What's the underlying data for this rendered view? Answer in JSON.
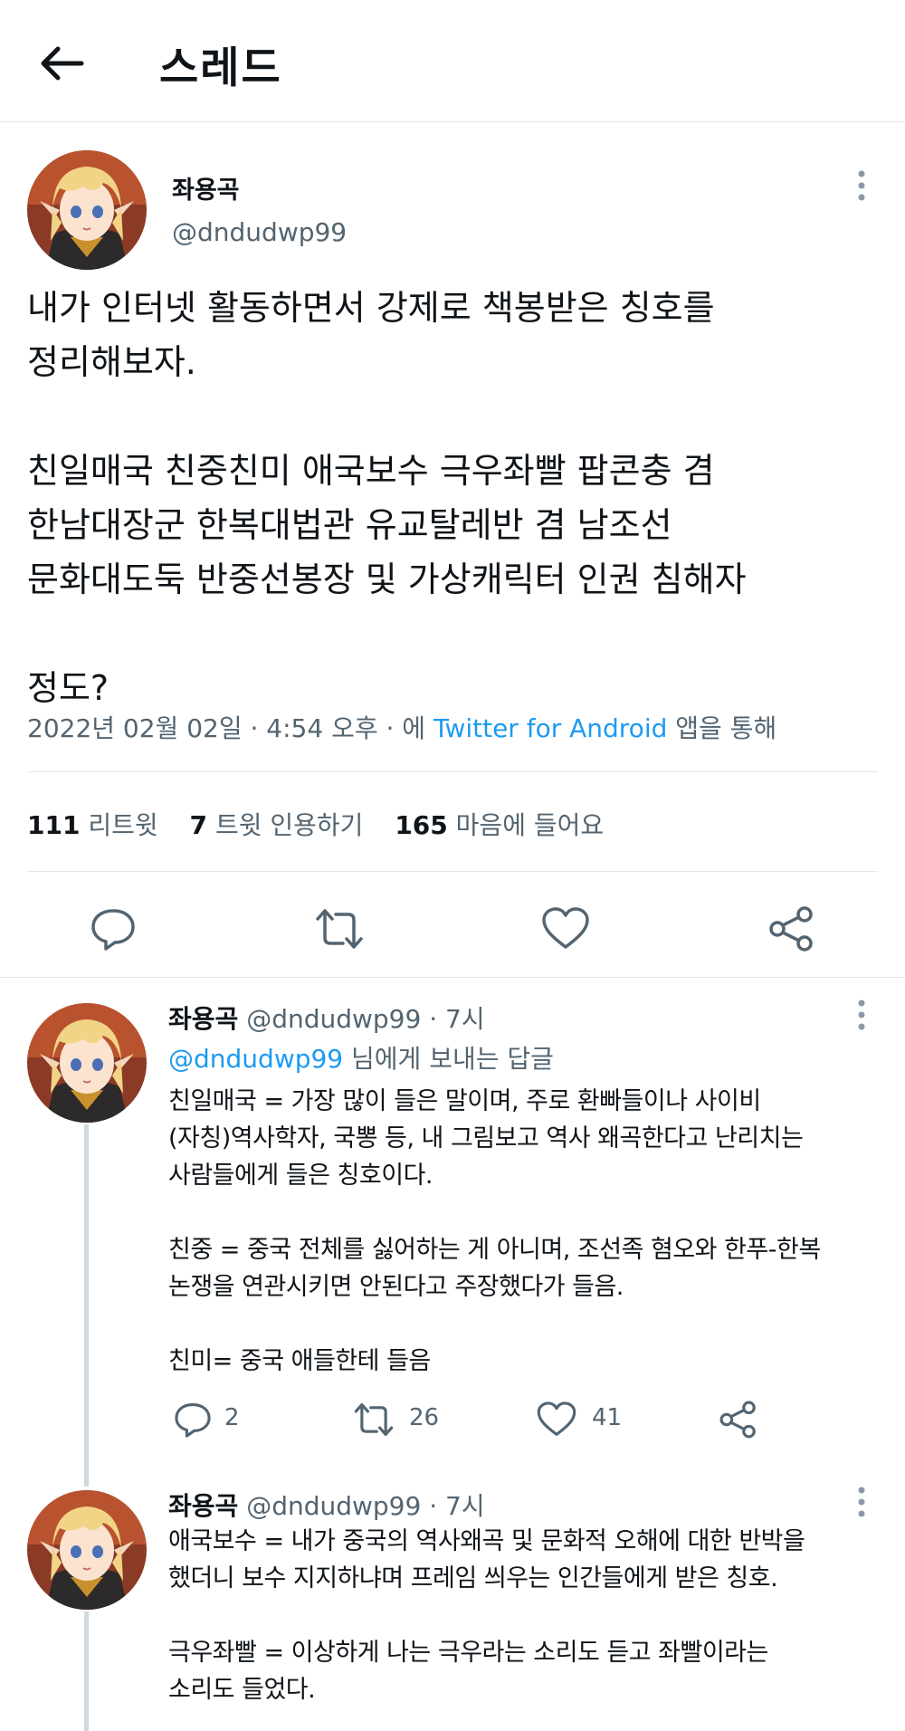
{
  "header": {
    "title": "스레드"
  },
  "main_tweet": {
    "name": "좌용곡",
    "handle": "@dndudwp99",
    "body": "내가 인터넷 활동하면서 강제로 책봉받은 칭호를\n정리해보자.\n\n친일매국 친중친미 애국보수 극우좌빨 팝콘충 겸\n한남대장군 한복대법관 유교탈레반 겸 남조선\n문화대도둑 반중선봉장 및 가상캐릭터 인권 침해자\n\n정도?",
    "meta_time": "2022년 02월 02일 · 4:54 오후 · 에 ",
    "meta_app": "Twitter for Android",
    "meta_suffix": " 앱을 통해",
    "stats": [
      {
        "num": "111",
        "label": "리트윗"
      },
      {
        "num": "7",
        "label": "트윗 인용하기"
      },
      {
        "num": "165",
        "label": "마음에 들어요"
      }
    ]
  },
  "replies": [
    {
      "name": "좌용곡",
      "handle": "@dndudwp99",
      "time": "· 7시",
      "reply_to_handle": "@dndudwp99",
      "reply_to_suffix": " 님에게 보내는 답글",
      "body": "친일매국 = 가장 많이 들은 말이며, 주로 환빠들이나 사이비\n(자칭)역사학자, 국뽕  등, 내 그림보고 역사 왜곡한다고 난리치는\n사람들에게 들은 칭호이다.\n\n친중 = 중국 전체를 싫어하는 게 아니며, 조선족 혐오와 한푸-한복\n논쟁을 연관시키면 안된다고 주장했다가 들음.\n\n친미= 중국 애들한테 들음",
      "replies_count": "2",
      "retweets_count": "26",
      "likes_count": "41"
    },
    {
      "name": "좌용곡",
      "handle": "@dndudwp99",
      "time": "· 7시",
      "body": "애국보수 = 내가 중국의 역사왜곡 및 문화적 오해에 대한 반박을\n했더니 보수 지지하냐며 프레임 씌우는 인간들에게 받은 칭호.\n\n극우좌빨 = 이상하게 나는 극우라는 소리도 듣고 좌빨이라는\n소리도 들었다."
    }
  ],
  "colors": {
    "link": "#1d9bf0",
    "secondary": "#536471",
    "divider": "#e6e6e6",
    "thread_line": "#cfd9de"
  },
  "icons": {
    "back": "arrow-left-icon",
    "more": "more-vertical-icon",
    "reply": "comment-icon",
    "retweet": "retweet-icon",
    "like": "heart-icon",
    "share": "share-icon",
    "avatar": "anime-elf-avatar"
  }
}
